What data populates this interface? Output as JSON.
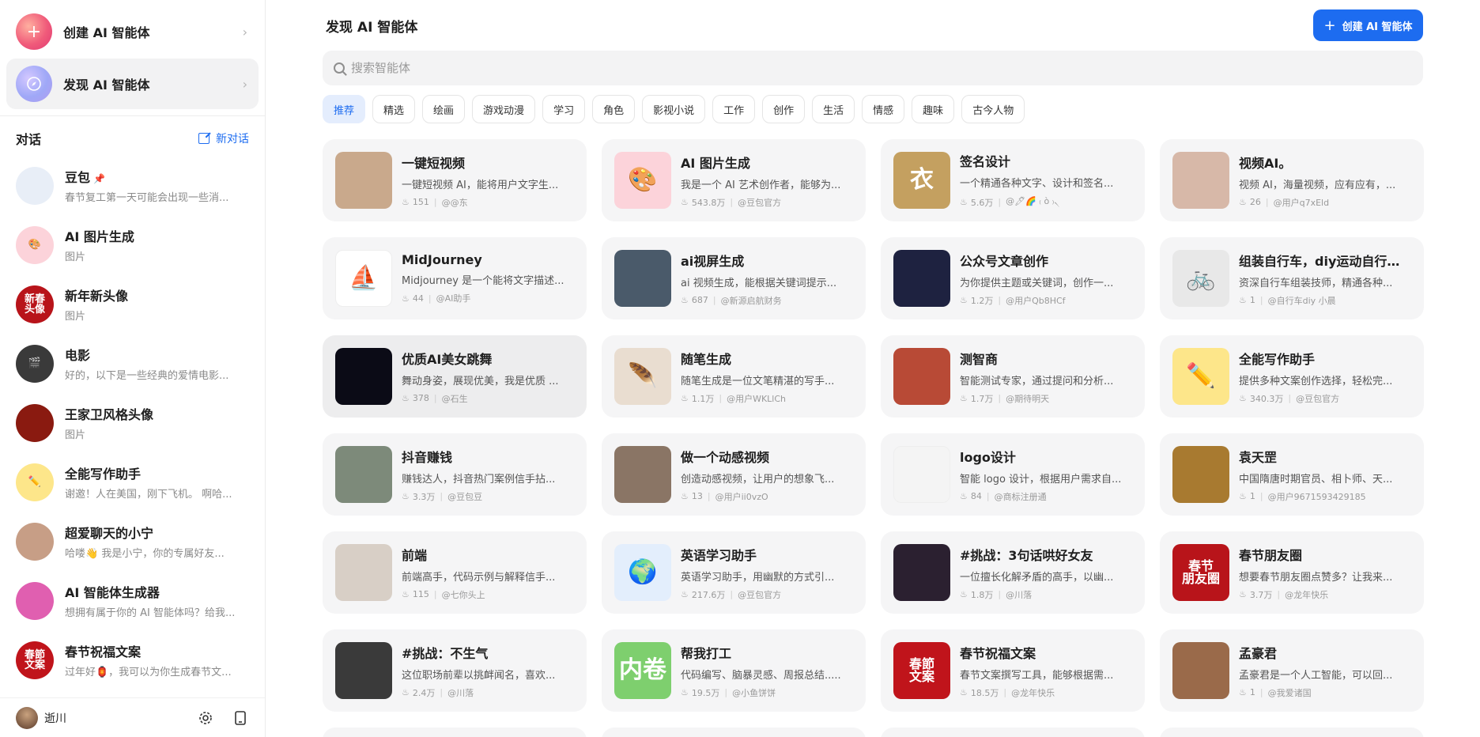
{
  "sidebar": {
    "create_label": "创建 AI 智能体",
    "discover_label": "发现 AI 智能体",
    "conversations_title": "对话",
    "new_chat_label": "新对话",
    "conversations": [
      {
        "name": "豆包",
        "sub": "春节复工第一天可能会出现一些消...",
        "avatar_text": "",
        "avatar_bg": "#e8eef7",
        "pinned": true
      },
      {
        "name": "AI 图片生成",
        "sub": "图片",
        "avatar_text": "🎨",
        "avatar_bg": "#fcd3da"
      },
      {
        "name": "新年新头像",
        "sub": "图片",
        "avatar_text": "新春\n头像",
        "avatar_bg": "#b8141a"
      },
      {
        "name": "电影",
        "sub": "好的，以下是一些经典的爱情电影...",
        "avatar_text": "🎬",
        "avatar_bg": "#3a3a3a"
      },
      {
        "name": "王家卫风格头像",
        "sub": "图片",
        "avatar_text": "",
        "avatar_bg": "#8a1a10"
      },
      {
        "name": "全能写作助手",
        "sub": "谢邀！人在美国，刚下飞机。 啊哈...",
        "avatar_text": "✏️",
        "avatar_bg": "#fde68a"
      },
      {
        "name": "超爱聊天的小宁",
        "sub": "哈喽👋 我是小宁，你的专属好友...",
        "avatar_text": "",
        "avatar_bg": "#c79e86"
      },
      {
        "name": "AI 智能体生成器",
        "sub": "想拥有属于你的 AI 智能体吗？给我...",
        "avatar_text": "",
        "avatar_bg": "#e05fb0"
      },
      {
        "name": "春节祝福文案",
        "sub": "过年好🏮，我可以为你生成春节文...",
        "avatar_text": "春節\n文案",
        "avatar_bg": "#c0141b"
      }
    ],
    "user_name": "逝川"
  },
  "header": {
    "title": "发现 AI 智能体",
    "create_button": "创建 AI 智能体",
    "search_placeholder": "搜索智能体"
  },
  "tabs": [
    "推荐",
    "精选",
    "绘画",
    "游戏动漫",
    "学习",
    "角色",
    "影视小说",
    "工作",
    "创作",
    "生活",
    "情感",
    "趣味",
    "古今人物"
  ],
  "active_tab": "推荐",
  "cards": [
    {
      "title": "一键短视频",
      "desc": "一键短视频 AI，能将用户文字生...",
      "count": "151",
      "author": "@@东",
      "img_bg": "#c9a98c",
      "img_text": ""
    },
    {
      "title": "AI 图片生成",
      "desc": "我是一个 AI 艺术创作者，能够为...",
      "count": "543.8万",
      "author": "@豆包官方",
      "img_bg": "#fcd3da",
      "img_text": "🎨"
    },
    {
      "title": "签名设计",
      "desc": "一个精通各种文字、设计和签名...",
      "count": "5.6万",
      "author": "@🖊🌈 ₍ ὸ ₎৲",
      "img_bg": "#c4a060",
      "img_text": "衣"
    },
    {
      "title": "视频AI。",
      "desc": "视频 AI，海量视频，应有应有，...",
      "count": "26",
      "author": "@用户q7xEld",
      "img_bg": "#d7b8a8",
      "img_text": ""
    },
    {
      "title": "MidJourney",
      "desc": "Midjourney 是一个能将文字描述...",
      "count": "44",
      "author": "@AI助手",
      "img_bg": "#ffffff",
      "img_text": "⛵"
    },
    {
      "title": "ai视屏生成",
      "desc": "ai 视频生成，能根据关键词提示...",
      "count": "687",
      "author": "@新源启航财务",
      "img_bg": "#4a5a6a",
      "img_text": ""
    },
    {
      "title": "公众号文章创作",
      "desc": "为你提供主题或关键词，创作一...",
      "count": "1.2万",
      "author": "@用户Qb8HCf",
      "img_bg": "#1e2240",
      "img_text": ""
    },
    {
      "title": "组装自行车，diy运动自行车...",
      "desc": "资深自行车组装技师，精通各种...",
      "count": "1",
      "author": "@自行车diy 小晨",
      "img_bg": "#e8e8e8",
      "img_text": "🚲"
    },
    {
      "title": "优质AI美女跳舞",
      "desc": "舞动身姿，展现优美，我是优质 ...",
      "count": "378",
      "author": "@石生",
      "img_bg": "#0b0b16",
      "img_text": ""
    },
    {
      "title": "随笔生成",
      "desc": "随笔生成是一位文笔精湛的写手...",
      "count": "1.1万",
      "author": "@用户WKLlCh",
      "img_bg": "#e9ddd0",
      "img_text": "🪶"
    },
    {
      "title": "测智商",
      "desc": "智能测试专家，通过提问和分析...",
      "count": "1.7万",
      "author": "@期待明天",
      "img_bg": "#b84a36",
      "img_text": ""
    },
    {
      "title": "全能写作助手",
      "desc": "提供多种文案创作选择，轻松完...",
      "count": "340.3万",
      "author": "@豆包官方",
      "img_bg": "#fde68a",
      "img_text": "✏️"
    },
    {
      "title": "抖音赚钱",
      "desc": "赚钱达人，抖音热门案例信手拈...",
      "count": "3.3万",
      "author": "@豆包豆",
      "img_bg": "#7d8a7a",
      "img_text": ""
    },
    {
      "title": "做一个动感视频",
      "desc": "创造动感视频，让用户的想象飞...",
      "count": "13",
      "author": "@用户ii0vzO",
      "img_bg": "#8a7565",
      "img_text": ""
    },
    {
      "title": "logo设计",
      "desc": "智能 logo 设计，根据用户需求自...",
      "count": "84",
      "author": "@商标注册通",
      "img_bg": "#f4f4f4",
      "img_text": ""
    },
    {
      "title": "袁天罡",
      "desc": "中国隋唐时期官员、相卜师、天...",
      "count": "1",
      "author": "@用户9671593429185",
      "img_bg": "#a87a30",
      "img_text": ""
    },
    {
      "title": "前端",
      "desc": "前端高手，代码示例与解释信手...",
      "count": "115",
      "author": "@七你头上",
      "img_bg": "#d8cfc6",
      "img_text": ""
    },
    {
      "title": "英语学习助手",
      "desc": "英语学习助手，用幽默的方式引...",
      "count": "217.6万",
      "author": "@豆包官方",
      "img_bg": "#e3eefc",
      "img_text": "🌍"
    },
    {
      "title": "#挑战：3句话哄好女友",
      "desc": "一位擅长化解矛盾的高手，以幽...",
      "count": "1.8万",
      "author": "@川落",
      "img_bg": "#2b2030",
      "img_text": ""
    },
    {
      "title": "春节朋友圈",
      "desc": "想要春节朋友圈点赞多？让我来...",
      "count": "3.7万",
      "author": "@龙年快乐",
      "img_bg": "#b8141a",
      "img_text": "春节\n朋友圈"
    },
    {
      "title": "#挑战：不生气",
      "desc": "这位职场前辈以挑衅闻名，喜欢...",
      "count": "2.4万",
      "author": "@川落",
      "img_bg": "#3a3a3a",
      "img_text": ""
    },
    {
      "title": "帮我打工",
      "desc": "代码编写、脑暴灵感、周报总结.....",
      "count": "19.5万",
      "author": "@小鱼饼饼",
      "img_bg": "#7ecf6e",
      "img_text": "内卷"
    },
    {
      "title": "春节祝福文案",
      "desc": "春节文案撰写工具，能够根据需...",
      "count": "18.5万",
      "author": "@龙年快乐",
      "img_bg": "#c0141b",
      "img_text": "春節\n文案"
    },
    {
      "title": "孟豪君",
      "desc": "孟豪君是一个人工智能，可以回...",
      "count": "1",
      "author": "@我爱诸国",
      "img_bg": "#9a6a4a",
      "img_text": ""
    }
  ],
  "colors": {
    "accent": "#1d6cf0",
    "card_bg": "#f5f5f6"
  }
}
